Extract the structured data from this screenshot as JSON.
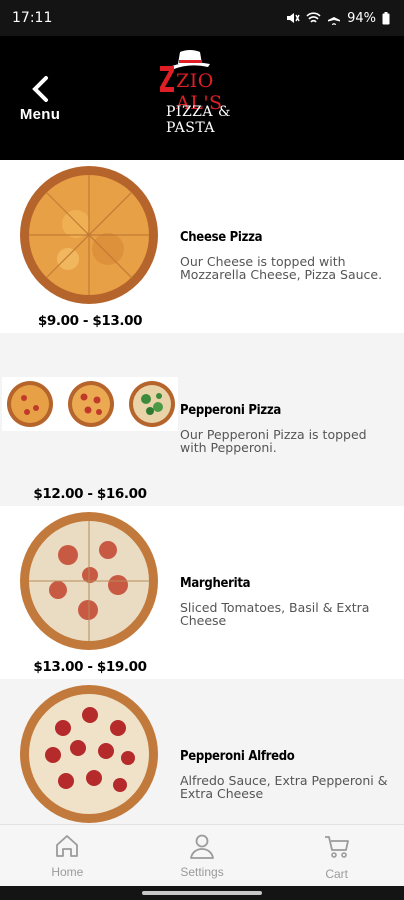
{
  "status_bar": {
    "time": "17:11",
    "battery": "94%"
  },
  "header": {
    "back_label": "Menu",
    "logo_name": "ZIO AL'S",
    "logo_sub": "PIZZA & PASTA"
  },
  "menu_items": [
    {
      "name": "Cheese Pizza",
      "description": "Our Cheese is topped with Mozzarella Cheese, Pizza Sauce.",
      "price": "$9.00 - $13.00"
    },
    {
      "name": "Pepperoni Pizza",
      "description": "Our Pepperoni Pizza is topped with Pepperoni.",
      "price": "$12.00 - $16.00"
    },
    {
      "name": "Margherita",
      "description": "Sliced Tomatoes, Basil & Extra Cheese",
      "price": "$13.00 - $19.00"
    },
    {
      "name": "Pepperoni Alfredo",
      "description": "Alfredo Sauce, Extra Pepperoni & Extra Cheese",
      "price": ""
    }
  ],
  "bottom_nav": [
    {
      "label": "Home",
      "icon": "home-icon"
    },
    {
      "label": "Settings",
      "icon": "person-icon"
    },
    {
      "label": "Cart",
      "icon": "cart-icon"
    }
  ],
  "colors": {
    "header_bg": "#000000",
    "brand_red": "#e01e26",
    "alt_row": "#f4f4f4"
  }
}
